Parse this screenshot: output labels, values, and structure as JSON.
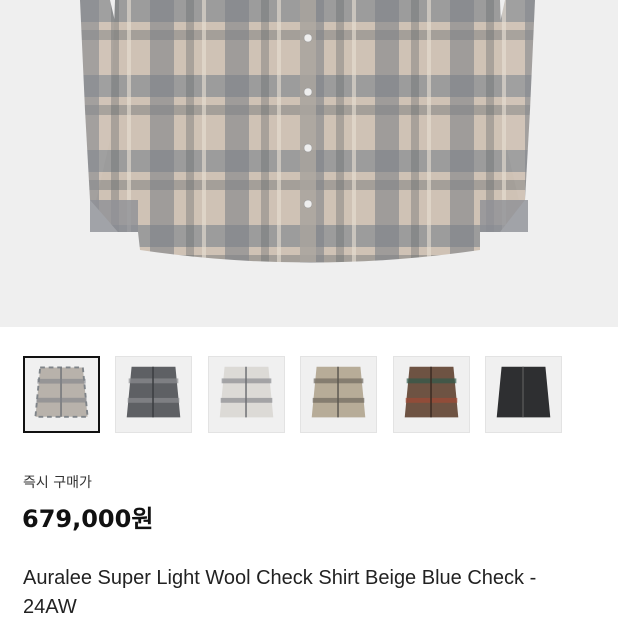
{
  "gallery": {
    "thumbnails": [
      {
        "name": "beige-blue-check",
        "selected": true
      },
      {
        "name": "grey-check",
        "selected": false
      },
      {
        "name": "white-check",
        "selected": false
      },
      {
        "name": "khaki-check",
        "selected": false
      },
      {
        "name": "brown-check",
        "selected": false
      },
      {
        "name": "black-shirt",
        "selected": false
      }
    ]
  },
  "product": {
    "buy_label": "즉시 구매가",
    "price": "679,000원",
    "title": "Auralee Super Light Wool Check Shirt Beige Blue Check - 24AW"
  }
}
